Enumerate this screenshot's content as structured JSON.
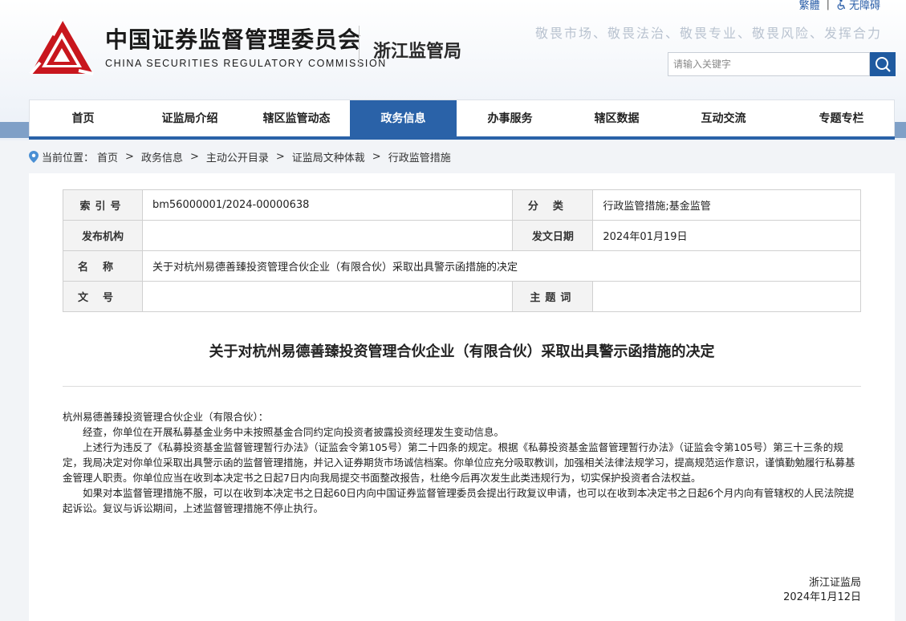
{
  "site": {
    "org_name_cn": "中国证券监督管理委员会",
    "org_name_en": "CHINA SECURITIES REGULATORY COMMISSION",
    "bureau": "浙江监管局",
    "slogan": "敬畏市场、敬畏法治、敬畏专业、敬畏风险、发挥合力",
    "top_links": {
      "traditional": "繁體",
      "accessibility": "无障碍"
    },
    "search_placeholder": "请输入关键字",
    "colors": {
      "brand_blue": "#2a62a8",
      "logo_red": "#c8161d"
    }
  },
  "nav": {
    "items": [
      "首页",
      "证监局介绍",
      "辖区监管动态",
      "政务信息",
      "办事服务",
      "辖区数据",
      "互动交流",
      "专题专栏"
    ],
    "active": "政务信息"
  },
  "breadcrumb": {
    "prefix": "当前位置：",
    "items": [
      "首页",
      "政务信息",
      "主动公开目录",
      "证监局文种体裁",
      "行政监管措施"
    ],
    "separator": ">"
  },
  "meta": {
    "index_label": "索引号",
    "index_value": "bm56000001/2024-00000638",
    "category_label": "分类",
    "category_value": "行政监管措施;基金监管",
    "publisher_label": "发布机构",
    "publisher_value": "",
    "date_label": "发文日期",
    "date_value": "2024年01月19日",
    "name_label": "名称",
    "name_value": "关于对杭州易德善臻投资管理合伙企业（有限合伙）采取出具警示函措施的决定",
    "docno_label": "文号",
    "docno_value": "",
    "keyword_label": "主题词",
    "keyword_value": ""
  },
  "document": {
    "title": "关于对杭州易德善臻投资管理合伙企业（有限合伙）采取出具警示函措施的决定",
    "salutation": "杭州易德善臻投资管理合伙企业（有限合伙）：",
    "paragraphs": [
      "经查，你单位在开展私募基金业务中未按照基金合同约定向投资者披露投资经理发生变动信息。",
      "上述行为违反了《私募投资基金监督管理暂行办法》（证监会令第105号）第二十四条的规定。根据《私募投资基金监督管理暂行办法》（证监会令第105号）第三十三条的规定，我局决定对你单位采取出具警示函的监督管理措施，并记入证券期货市场诚信档案。你单位应充分吸取教训，加强相关法律法规学习，提高规范运作意识，谨慎勤勉履行私募基金管理人职责。你单位应当在收到本决定书之日起7日内向我局提交书面整改报告，杜绝今后再次发生此类违规行为，切实保护投资者合法权益。",
      "如果对本监督管理措施不服，可以在收到本决定书之日起60日内向中国证券监督管理委员会提出行政复议申请，也可以在收到本决定书之日起6个月内向有管辖权的人民法院提起诉讼。复议与诉讼期间，上述监督管理措施不停止执行。"
    ],
    "signer": "浙江证监局",
    "sign_date": "2024年1月12日"
  }
}
